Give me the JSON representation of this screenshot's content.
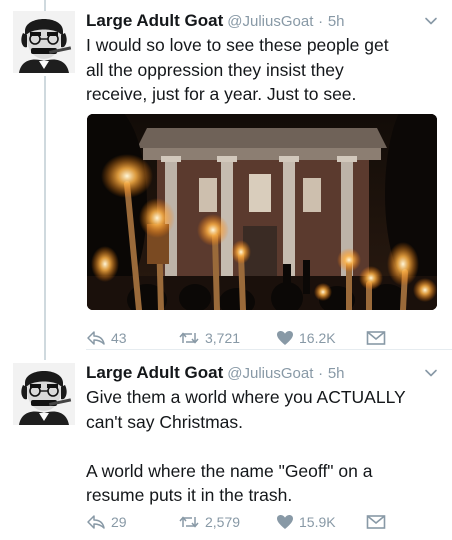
{
  "tweets": [
    {
      "name": "Large Adult Goat",
      "handle": "@JuliusGoat",
      "separator": "·",
      "time": "5h",
      "text_lines": [
        "I would so love to see these people get",
        "all the oppression they insist they",
        "receive, just for a year. Just to see."
      ],
      "has_media": true,
      "replies": "43",
      "retweets": "3,721",
      "likes": "16.2K"
    },
    {
      "name": "Large Adult Goat",
      "handle": "@JuliusGoat",
      "separator": "·",
      "time": "5h",
      "text_lines": [
        "Give them a world where you ACTUALLY",
        "can't say Christmas.",
        "",
        "A world where the name \"Geoff\" on a",
        "resume puts it in the trash."
      ],
      "has_media": false,
      "replies": "29",
      "retweets": "2,579",
      "likes": "15.9K"
    }
  ],
  "icons": {
    "reply": "reply-icon",
    "retweet": "retweet-icon",
    "like": "heart-icon",
    "dm": "direct-message-icon",
    "caret": "chevron-down-icon"
  },
  "colors": {
    "icon_gray": "#8899a6",
    "text": "#14171a",
    "thread_line": "#cfd9de"
  }
}
